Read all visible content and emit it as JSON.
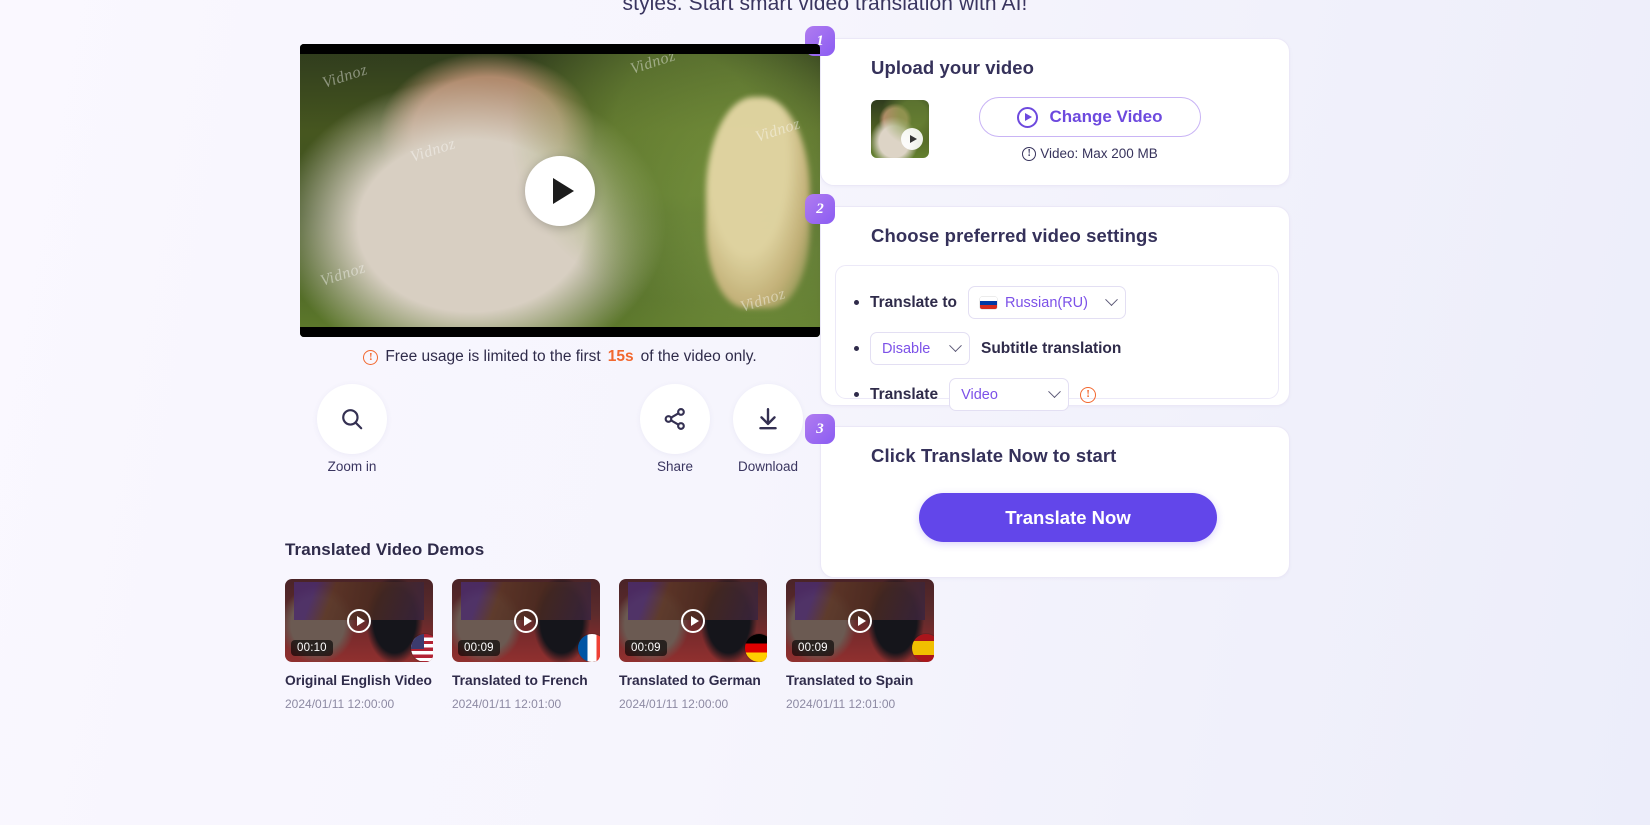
{
  "hero": {
    "tagline": "styles. Start smart video translation with AI!"
  },
  "player": {
    "watermark": "Vidnoz",
    "play_icon": "play-icon",
    "limit_prefix": "Free usage is limited to the first",
    "limit_highlight": "15s",
    "limit_suffix": "of the video only.",
    "info_glyph": "!"
  },
  "actions": [
    {
      "label": "Zoom in",
      "icon": "magnifier-icon"
    },
    {
      "label": "Share",
      "icon": "share-icon"
    },
    {
      "label": "Download",
      "icon": "download-icon"
    }
  ],
  "demos": {
    "heading": "Translated Video Demos",
    "items": [
      {
        "duration": "00:10",
        "title": "Original English Video",
        "date": "2024/01/11 12:00:00",
        "flag": "us"
      },
      {
        "duration": "00:09",
        "title": "Translated to French",
        "date": "2024/01/11 12:01:00",
        "flag": "fr"
      },
      {
        "duration": "00:09",
        "title": "Translated to German",
        "date": "2024/01/11 12:00:00",
        "flag": "de"
      },
      {
        "duration": "00:09",
        "title": "Translated to Spain",
        "date": "2024/01/11 12:01:00",
        "flag": "es"
      }
    ]
  },
  "steps": {
    "one": {
      "number": "1",
      "title": "Upload your video",
      "change_button": "Change Video",
      "max_note": "Video: Max 200 MB",
      "info_glyph": "!"
    },
    "two": {
      "number": "2",
      "title": "Choose preferred video settings",
      "translate_to_label": "Translate to",
      "language_value": "Russian(RU)",
      "subtitle_value": "Disable",
      "subtitle_label": "Subtitle translation",
      "translate_label": "Translate",
      "mode_value": "Video",
      "info_glyph": "!"
    },
    "three": {
      "number": "3",
      "title": "Click Translate Now to start",
      "button": "Translate Now"
    }
  },
  "colors": {
    "accent_purple": "#6246ea",
    "link_purple": "#7c51e8",
    "badge_gradient_start": "#b07cf0",
    "badge_gradient_end": "#8b5cf2",
    "warning_orange": "#f2682f",
    "page_bg": "#f6f5fd"
  }
}
